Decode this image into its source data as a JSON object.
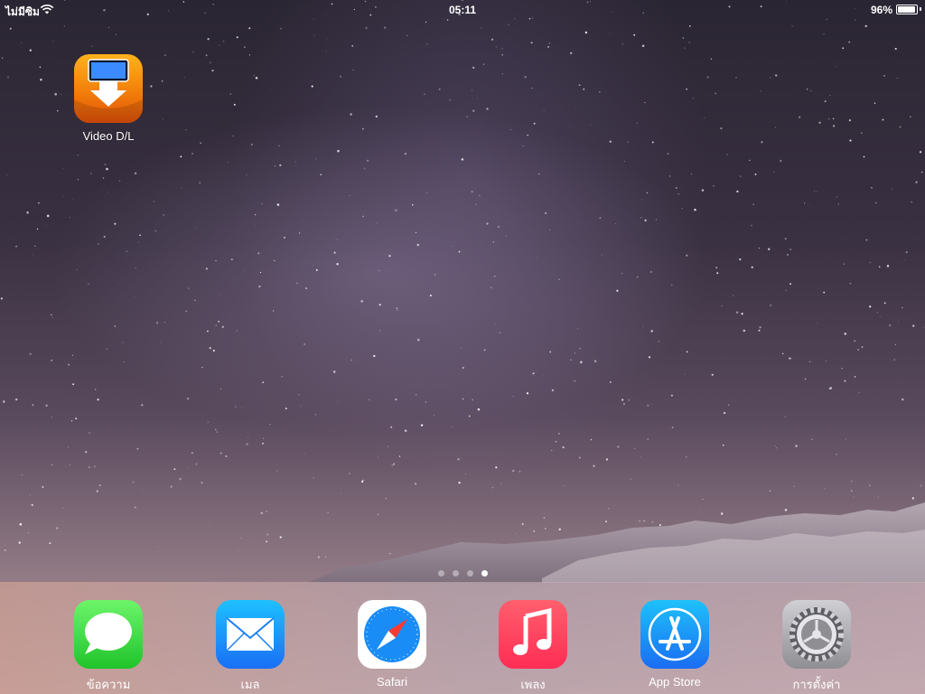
{
  "status": {
    "carrier": "ไม่มีซิม",
    "time": "05:11",
    "battery_pct": "96%",
    "battery_level": 0.96
  },
  "home": {
    "apps": [
      {
        "label": "Video D/L",
        "icon": "video-download-icon"
      }
    ],
    "page_count": 4,
    "current_page": 4
  },
  "dock": {
    "apps": [
      {
        "label": "ข้อความ",
        "icon": "messages-icon"
      },
      {
        "label": "เมล",
        "icon": "mail-icon"
      },
      {
        "label": "Safari",
        "icon": "safari-icon"
      },
      {
        "label": "เพลง",
        "icon": "music-icon"
      },
      {
        "label": "App Store",
        "icon": "app-store-icon"
      },
      {
        "label": "การตั้งค่า",
        "icon": "settings-icon"
      }
    ]
  },
  "colors": {
    "video": "#f07a0a",
    "messages": "#1fc42b",
    "mail": "#1a6ff5",
    "music": "#ff2d55",
    "appstore": "#1a6df2",
    "settings": "#8e8e93"
  }
}
